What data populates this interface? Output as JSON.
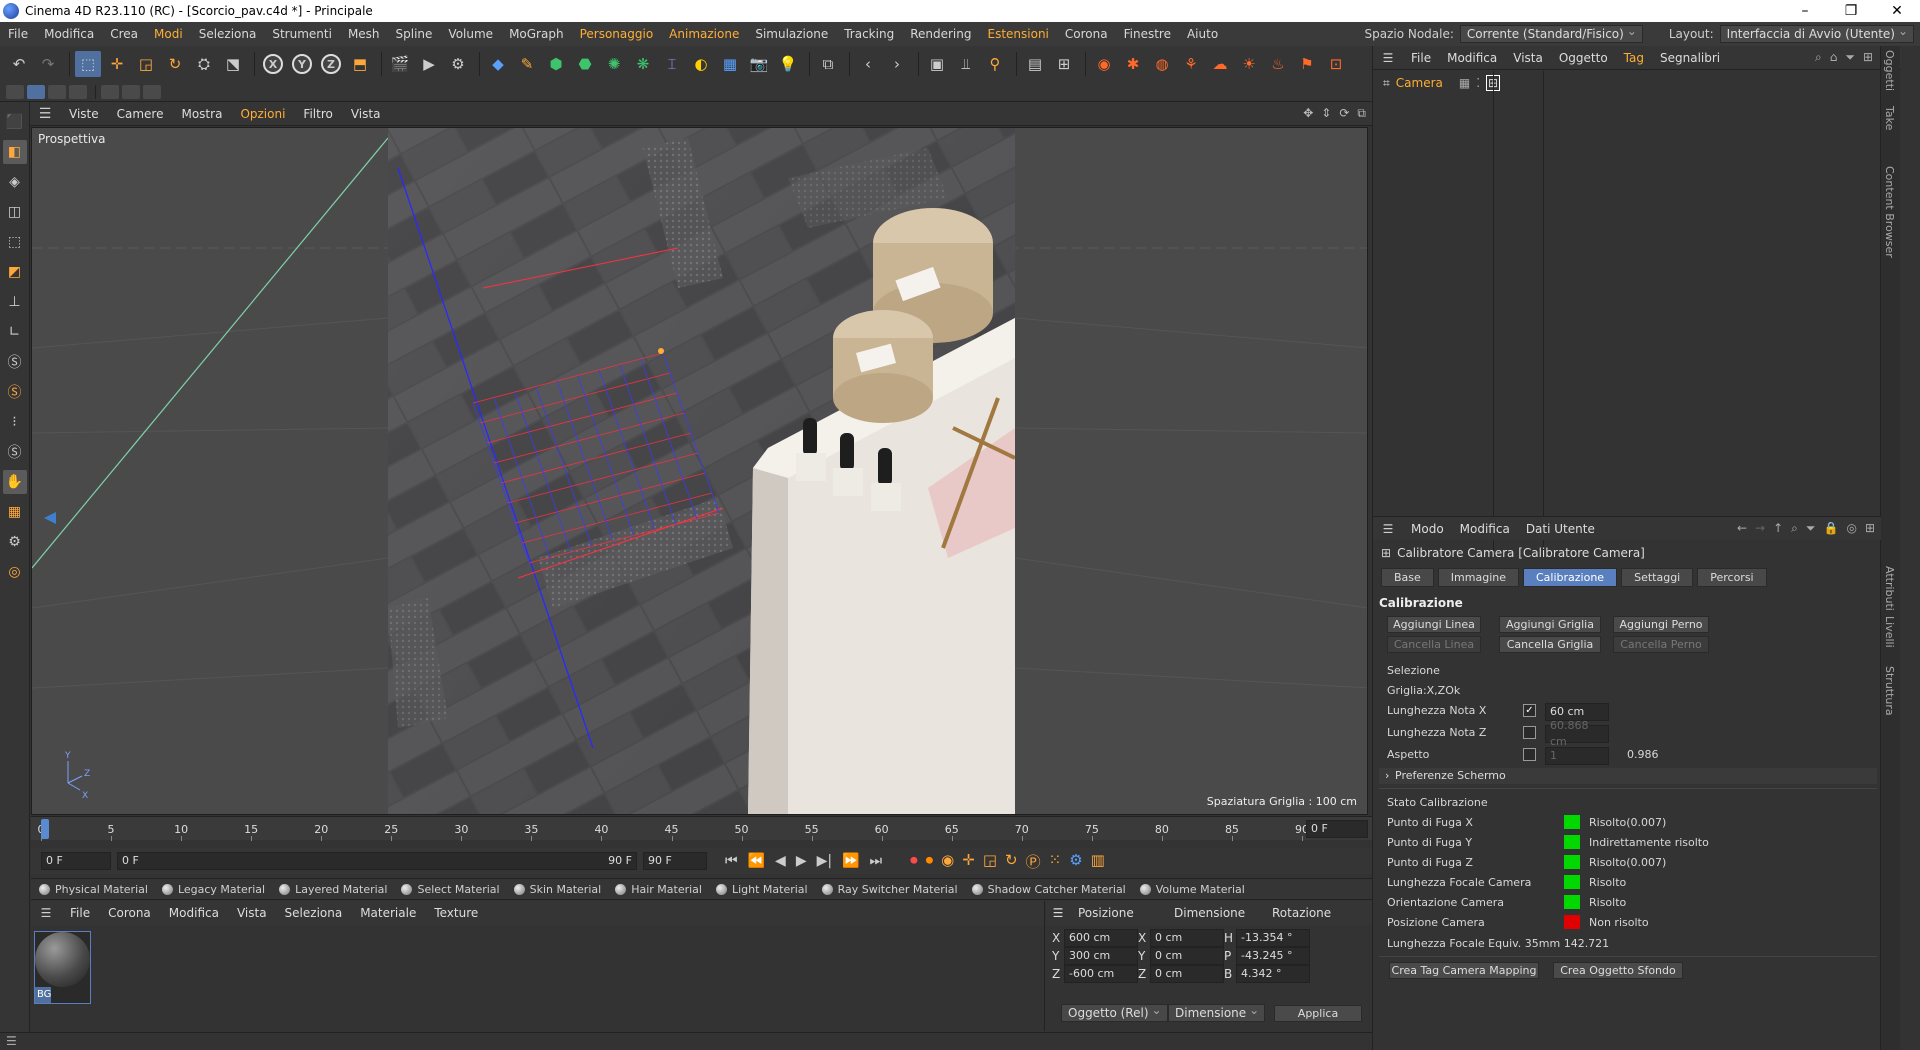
{
  "window": {
    "title": "Cinema 4D R23.110 (RC) - [Scorcio_pav.c4d *] - Principale",
    "minimize": "–",
    "maximize": "❐",
    "close": "✕"
  },
  "menu": {
    "items": [
      "File",
      "Modifica",
      "Crea",
      "Modi",
      "Seleziona",
      "Strumenti",
      "Mesh",
      "Spline",
      "Volume",
      "MoGraph",
      "Personaggio",
      "Animazione",
      "Simulazione",
      "Tracking",
      "Rendering",
      "Estensioni",
      "Corona",
      "Finestre",
      "Aiuto"
    ],
    "highlighted": [
      "Modi",
      "Personaggio",
      "Animazione",
      "Estensioni"
    ],
    "node_space_label": "Spazio Nodale:",
    "node_space_value": "Corrente (Standard/Fisico)",
    "layout_label": "Layout:",
    "layout_value": "Interfaccia di Avvio (Utente)"
  },
  "viewport": {
    "menu": [
      "Viste",
      "Camere",
      "Mostra",
      "Opzioni",
      "Filtro",
      "Vista"
    ],
    "highlighted": "Opzioni",
    "label": "Prospettiva",
    "grid_spacing": "Spaziatura Griglia : 100 cm"
  },
  "timeline": {
    "ticks": [
      "0",
      "5",
      "10",
      "15",
      "20",
      "25",
      "30",
      "35",
      "40",
      "45",
      "50",
      "55",
      "60",
      "65",
      "70",
      "75",
      "80",
      "85",
      "90"
    ],
    "current": "0 F",
    "start": "0 F",
    "start2": "0 F",
    "end": "90 F",
    "end2": "90 F"
  },
  "materials_tabs": [
    "Physical Material",
    "Legacy Material",
    "Layered Material",
    "Select Material",
    "Skin Material",
    "Hair Material",
    "Light Material",
    "Ray Switcher Material",
    "Shadow Catcher Material",
    "Volume Material"
  ],
  "material_manager": {
    "menu": [
      "File",
      "Corona",
      "Modifica",
      "Vista",
      "Seleziona",
      "Materiale",
      "Texture"
    ],
    "swatch": "BG"
  },
  "coords": {
    "headers": [
      "Posizione",
      "Dimensione",
      "Rotazione"
    ],
    "rows": [
      {
        "a": "X",
        "pos": "600 cm",
        "b": "X",
        "dim": "0 cm",
        "c": "H",
        "rot": "-13.354 °"
      },
      {
        "a": "Y",
        "pos": "300 cm",
        "b": "Y",
        "dim": "0 cm",
        "c": "P",
        "rot": "-43.245 °"
      },
      {
        "a": "Z",
        "pos": "-600 cm",
        "b": "Z",
        "dim": "0 cm",
        "c": "B",
        "rot": "4.342 °"
      }
    ],
    "mode": "Oggetto (Rel)",
    "dim_mode": "Dimensione",
    "apply": "Applica"
  },
  "objects": {
    "menu": [
      "File",
      "Modifica",
      "Vista",
      "Oggetto",
      "Tag",
      "Segnalibri"
    ],
    "highlighted": "Tag",
    "items": [
      {
        "name": "Camera"
      }
    ]
  },
  "side_tabs": [
    "Oggetti",
    "Take",
    "Content Browser",
    "Attributi",
    "Livelli",
    "Struttura"
  ],
  "attributes": {
    "menu": [
      "Modo",
      "Modifica",
      "Dati Utente"
    ],
    "title": "Calibratore Camera [Calibratore Camera]",
    "tabs": [
      "Base",
      "Immagine",
      "Calibrazione",
      "Settaggi",
      "Percorsi"
    ],
    "active_tab": "Calibrazione",
    "section": "Calibrazione",
    "buttons": {
      "add_line": "Aggiungi Linea",
      "add_grid": "Aggiungi Griglia",
      "add_pin": "Aggiungi Perno",
      "del_line": "Cancella Linea",
      "del_grid": "Cancella Griglia",
      "del_pin": "Cancella Perno"
    },
    "selection_label": "Selezione",
    "selection_value": "Griglia:X,ZOk",
    "len_x_label": "Lunghezza Nota X",
    "len_x_value": "60 cm",
    "len_x_checked": true,
    "len_z_label": "Lunghezza Nota Z",
    "len_z_value": "60.868 cm",
    "len_z_checked": false,
    "aspect_label": "Aspetto",
    "aspect_value": "1",
    "aspect_result": "0.986",
    "aspect_checked": false,
    "screen_prefs": "Preferenze Schermo",
    "status_title": "Stato Calibrazione",
    "status": [
      {
        "label": "Punto di Fuga X",
        "value": "Risolto(0.007)",
        "color": "#00d800"
      },
      {
        "label": "Punto di Fuga Y",
        "value": "Indirettamente risolto",
        "color": "#00d800"
      },
      {
        "label": "Punto di Fuga Z",
        "value": "Risolto(0.007)",
        "color": "#00d800"
      },
      {
        "label": "Lunghezza Focale Camera",
        "value": "Risolto",
        "color": "#00d800"
      },
      {
        "label": "Orientazione Camera",
        "value": "Risolto",
        "color": "#00d800"
      },
      {
        "label": "Posizione Camera",
        "value": "Non risolto",
        "color": "#e00000"
      }
    ],
    "focal_equiv": "Lunghezza Focale Equiv. 35mm 142.721",
    "btn_tag": "Crea Tag Camera Mapping",
    "btn_bg": "Crea Oggetto Sfondo"
  }
}
